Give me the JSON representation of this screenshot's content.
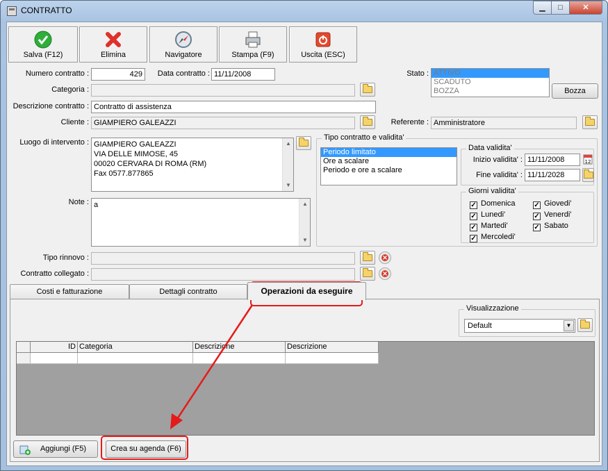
{
  "window": {
    "title": "CONTRATTO",
    "min_glyph": "▁",
    "max_glyph": "□",
    "close_glyph": "✕"
  },
  "toolbar": [
    {
      "label": "Salva (F12)",
      "icon": "check-icon"
    },
    {
      "label": "Elimina",
      "icon": "red-x-icon"
    },
    {
      "label": "Navigatore",
      "icon": "compass-icon"
    },
    {
      "label": "Stampa (F9)",
      "icon": "printer-icon"
    },
    {
      "label": "Uscita (ESC)",
      "icon": "power-icon"
    }
  ],
  "form": {
    "numero_label": "Numero contratto :",
    "numero_value": "429",
    "data_label": "Data contratto :",
    "data_value": "11/11/2008",
    "stato_label": "Stato :",
    "stato_options": [
      "ATTIVO",
      "SCADUTO",
      "BOZZA"
    ],
    "bozza_button": "Bozza",
    "categoria_label": "Categoria :",
    "categoria_value": "",
    "descrizione_label": "Descrizione contratto :",
    "descrizione_value": "Contratto di assistenza",
    "cliente_label": "Cliente :",
    "cliente_value": "GIAMPIERO GALEAZZI",
    "referente_label": "Referente :",
    "referente_value": "Amministratore",
    "luogo_label": "Luogo di intervento :",
    "luogo_lines": [
      "GIAMPIERO GALEAZZI",
      "VIA DELLE MIMOSE, 45",
      "00020 CERVARA DI ROMA (RM)",
      "Fax 0577.877865"
    ],
    "note_label": "Note :",
    "note_value": "a",
    "tipo_rinnovo_label": "Tipo rinnovo :",
    "contratto_collegato_label": "Contratto collegato :"
  },
  "tipo_validita": {
    "title": "Tipo contratto e validita'",
    "options": [
      "Periodo limitato",
      "Ore a scalare",
      "Periodo e ore a scalare"
    ],
    "selected": 0,
    "data_validita_title": "Data validita'",
    "inizio_label": "Inizio validita' :",
    "inizio_value": "11/11/2008",
    "fine_label": "Fine validita' :",
    "fine_value": "11/11/2028",
    "giorni_title": "Giorni validita'",
    "giorni": [
      {
        "label": "Domenica",
        "checked": true
      },
      {
        "label": "Lunedi'",
        "checked": true
      },
      {
        "label": "Martedi'",
        "checked": true
      },
      {
        "label": "Mercoledi'",
        "checked": true
      },
      {
        "label": "Giovedi'",
        "checked": true
      },
      {
        "label": "Venerdi'",
        "checked": true
      },
      {
        "label": "Sabato",
        "checked": true
      }
    ]
  },
  "tabs": [
    "Costi e fatturazione",
    "Dettagli contratto",
    "Operazioni da eseguire"
  ],
  "active_tab": 2,
  "panel": {
    "visualizzazione_title": "Visualizzazione",
    "visualizzazione_value": "Default",
    "grid_columns": [
      "ID",
      "Categoria",
      "Descrizione",
      "Descrizione"
    ],
    "aggiungi_button": "Aggiungi (F5)",
    "crea_button": "Crea su agenda (F6)"
  },
  "colors": {
    "highlight": "#e51a1a",
    "selection": "#3399ff"
  }
}
